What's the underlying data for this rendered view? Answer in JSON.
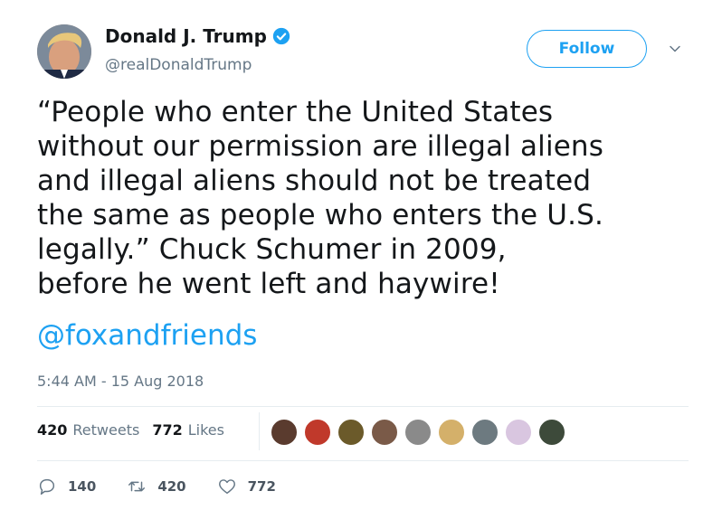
{
  "author": {
    "name": "Donald J. Trump",
    "handle": "@realDonaldTrump"
  },
  "follow_label": "Follow",
  "tweet": {
    "text": "“People who enter the United States\nwithout our permission are illegal aliens\nand illegal aliens should not be treated\nthe same as people who enters the U.S.\nlegally.”  Chuck Schumer in 2009,\nbefore he went left and haywire!",
    "mention": "@foxandfriends",
    "timestamp": "5:44 AM - 15 Aug 2018"
  },
  "stats": {
    "retweets_count": "420",
    "retweets_label": "Retweets",
    "likes_count": "772",
    "likes_label": "Likes"
  },
  "liker_avatar_colors": [
    "#5a3b2e",
    "#c0392b",
    "#6b5a2a",
    "#7a5a48",
    "#8a8a8a",
    "#d4b06a",
    "#6d7a80",
    "#d9c6e0",
    "#3d4a3a"
  ],
  "actions": {
    "replies": "140",
    "retweets": "420",
    "likes": "772"
  },
  "colors": {
    "accent": "#1da1f2",
    "text": "#14171a",
    "muted": "#657786"
  }
}
